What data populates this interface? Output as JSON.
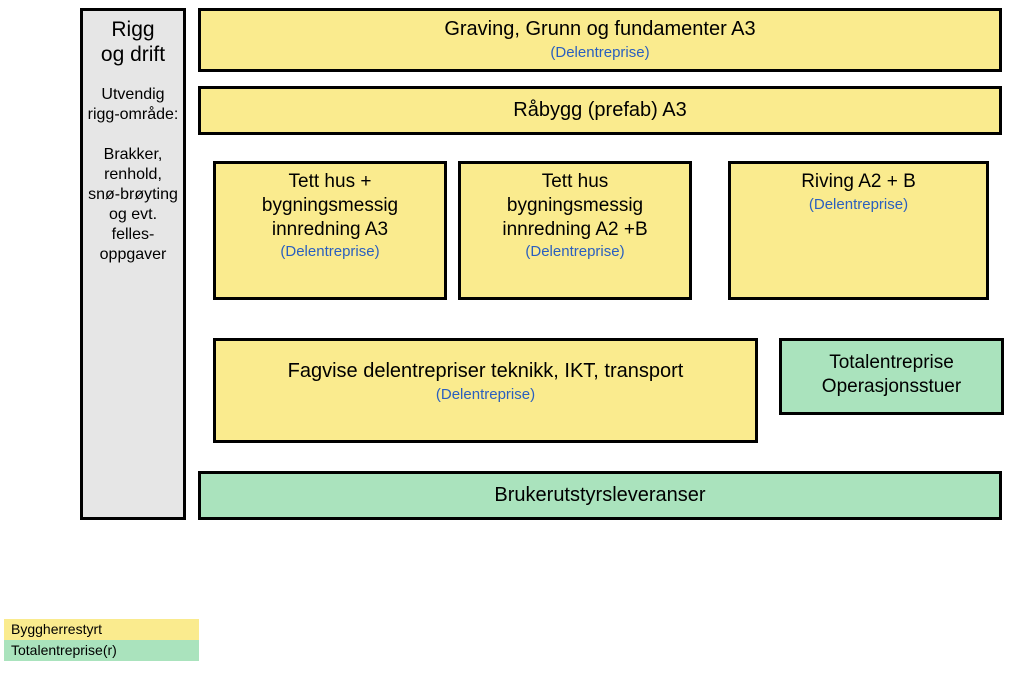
{
  "sidebar": {
    "title_line1": "Rigg",
    "title_line2": "og drift",
    "body_intro": "Utvendig rigg-område:",
    "body_detail": "Brakker, renhold, snø-brøyting og evt. felles-oppgaver"
  },
  "row1": {
    "title": "Graving, Grunn og fundamenter A3",
    "sub": "(Delentreprise)"
  },
  "row2": {
    "title": "Råbygg (prefab) A3"
  },
  "row3": {
    "box1_line1": "Tett hus +",
    "box1_line2": "bygningsmessig",
    "box1_line3": "innredning A3",
    "box1_sub": "(Delentreprise)",
    "box2_line1": "Tett hus",
    "box2_line2": "bygningsmessig",
    "box2_line3": "innredning A2 +B",
    "box2_sub": "(Delentreprise)",
    "box3_line1": "Riving A2 + B",
    "box3_sub": "(Delentreprise)"
  },
  "row4": {
    "box1_title": "Fagvise delentrepriser teknikk, IKT, transport",
    "box1_sub": "(Delentreprise)",
    "box2_line1": "Totalentreprise",
    "box2_line2": "Operasjonsstuer"
  },
  "row5": {
    "title": "Brukerutstyrsleveranser"
  },
  "legend": {
    "label_yellow": "Byggherrestyrt",
    "label_green": "Totalentreprise(r)"
  },
  "colors": {
    "yellow": "#faeb8e",
    "green": "#aae3bd",
    "grey": "#e6e6e6",
    "link": "#2a5fbf"
  }
}
